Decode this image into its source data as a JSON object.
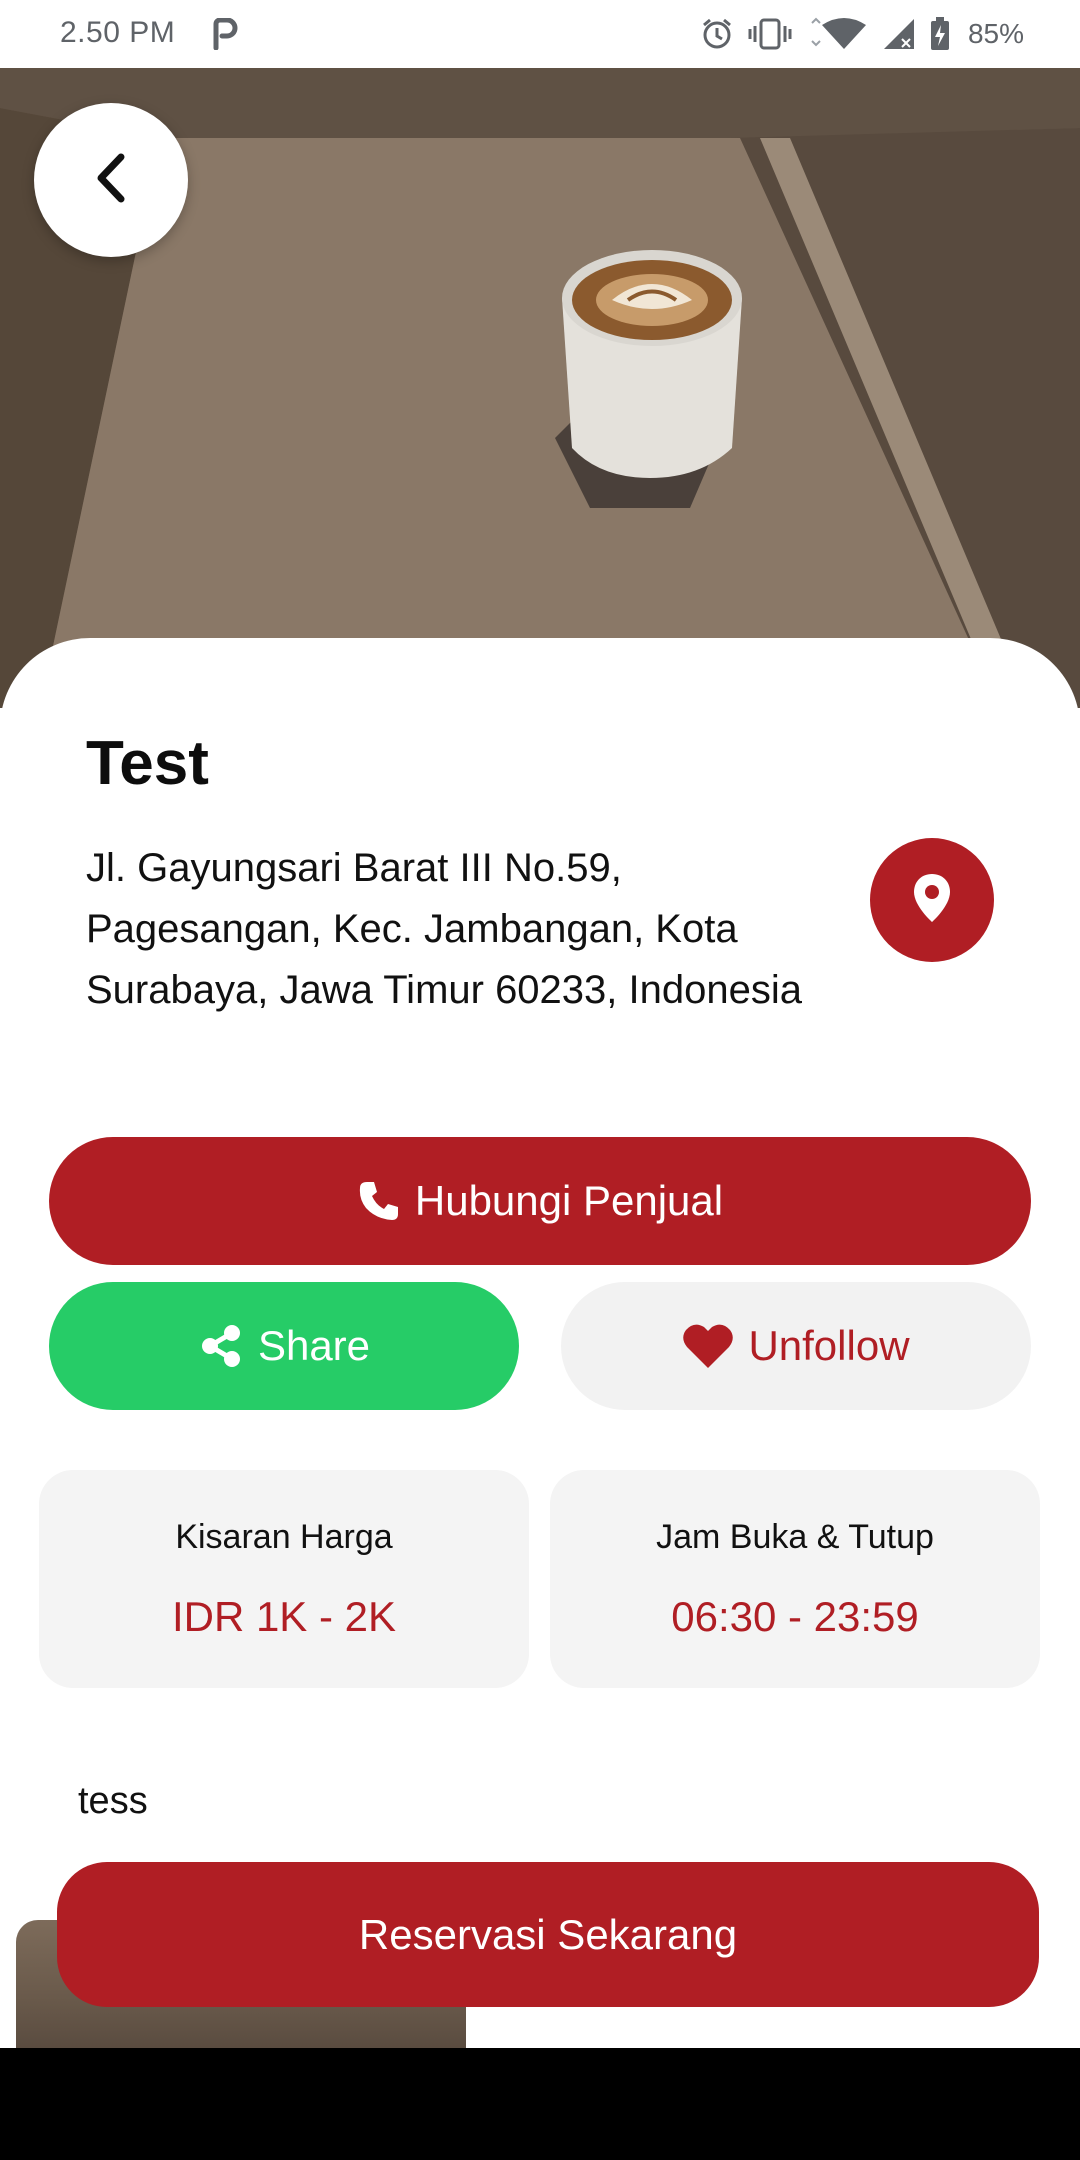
{
  "status_bar": {
    "time": "2.50 PM",
    "battery": "85%",
    "icons": [
      "parking-app-icon",
      "alarm-icon",
      "vibrate-icon",
      "wifi-icon",
      "signal-icon",
      "battery-icon"
    ]
  },
  "hero": {
    "image": "latte-cup-on-table-photo"
  },
  "header": {
    "back_icon": "chevron-left-icon"
  },
  "store": {
    "name": "Test",
    "address": "Jl. Gayungsari Barat III No.59, Pagesangan, Kec. Jambangan, Kota Surabaya, Jawa Timur 60233, Indonesia",
    "map_icon": "map-pin-icon"
  },
  "actions": {
    "contact_label": "Hubungi Penjual",
    "contact_icon": "phone-icon",
    "share_label": "Share",
    "share_icon": "share-icon",
    "unfollow_label": "Unfollow",
    "unfollow_icon": "heart-icon"
  },
  "info": {
    "price_label": "Kisaran Harga",
    "price_value": "IDR 1K - 2K",
    "hours_label": "Jam Buka & Tutup",
    "hours_value": "06:30 - 23:59"
  },
  "description": "tess",
  "reserve_label": "Reservasi Sekarang",
  "colors": {
    "primary_red": "#b01e24",
    "share_green": "#26cc67",
    "card_bg": "#f4f4f4"
  }
}
